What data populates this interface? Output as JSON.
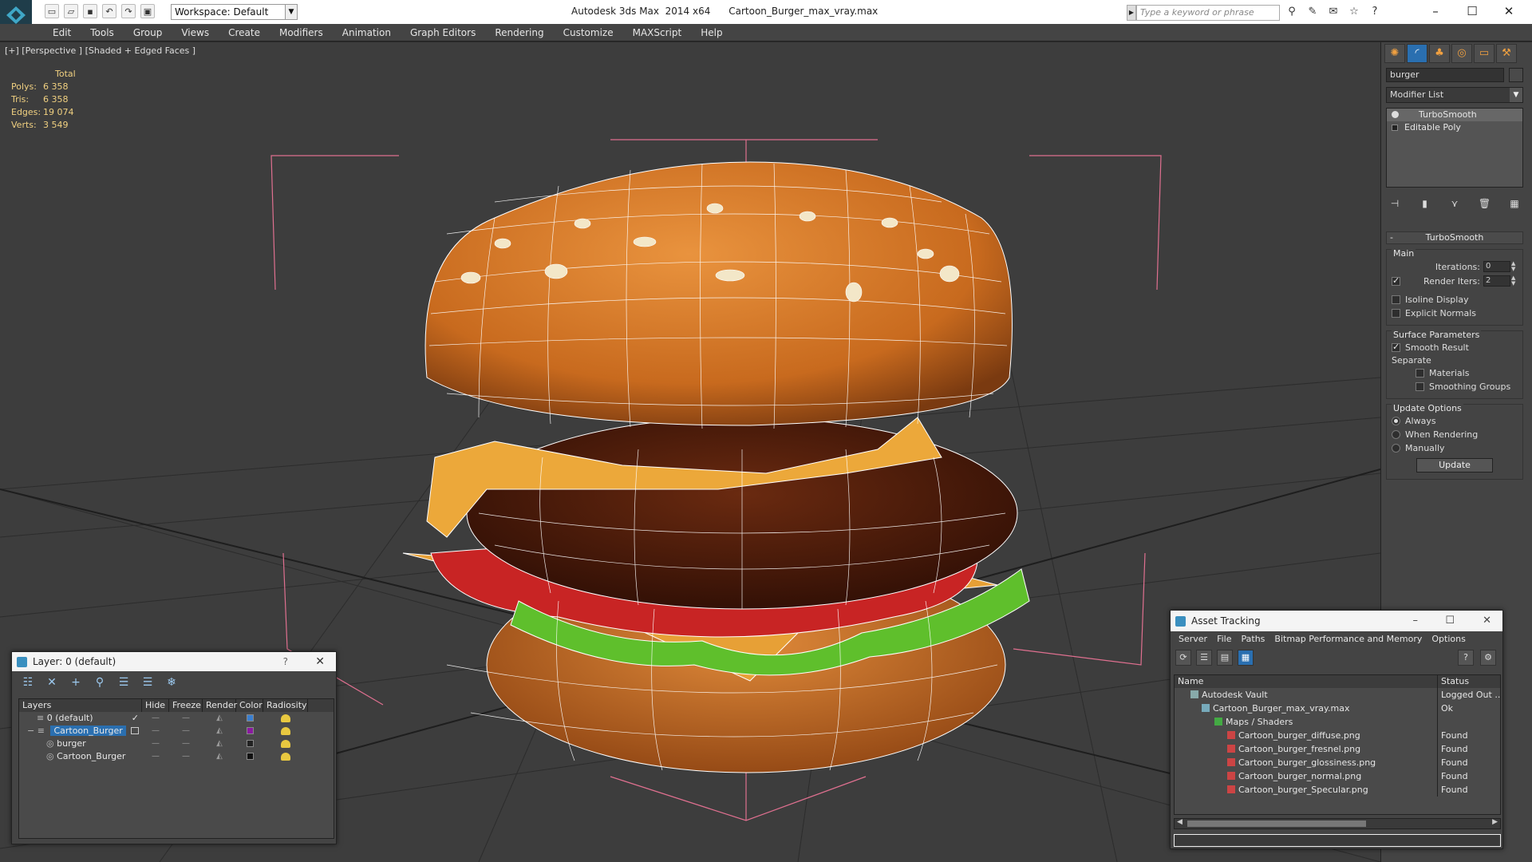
{
  "app": {
    "title": "Autodesk 3ds Max  2014 x64      Cartoon_Burger_max_vray.max",
    "workspace": "Workspace: Default",
    "search_placeholder": "Type a keyword or phrase"
  },
  "menu": [
    "Edit",
    "Tools",
    "Group",
    "Views",
    "Create",
    "Modifiers",
    "Animation",
    "Graph Editors",
    "Rendering",
    "Customize",
    "MAXScript",
    "Help"
  ],
  "viewport": {
    "label": "[+] [Perspective ] [Shaded + Edged Faces ]",
    "stats": {
      "header": "Total",
      "rows": [
        {
          "k": "Polys:",
          "v": "6 358"
        },
        {
          "k": "Tris:",
          "v": "6 358"
        },
        {
          "k": "Edges:",
          "v": "19 074"
        },
        {
          "k": "Verts:",
          "v": "3 549"
        }
      ]
    }
  },
  "command_panel": {
    "object_name": "burger",
    "modifier_list": "Modifier List",
    "stack": [
      "TurboSmooth",
      "Editable Poly"
    ],
    "rollout": {
      "title": "TurboSmooth",
      "main_label": "Main",
      "iterations_label": "Iterations:",
      "iterations_value": "0",
      "render_iters_label": "Render Iters:",
      "render_iters_value": "2",
      "isoline": "Isoline Display",
      "explicit_normals": "Explicit Normals",
      "surface_label": "Surface Parameters",
      "smooth_result": "Smooth Result",
      "separate_label": "Separate",
      "materials": "Materials",
      "smoothing_groups": "Smoothing Groups",
      "update_label": "Update Options",
      "always": "Always",
      "when_rendering": "When Rendering",
      "manually": "Manually",
      "update_button": "Update"
    }
  },
  "layer_window": {
    "title": "Layer: 0 (default)",
    "help": "?",
    "columns": [
      "Layers",
      "Hide",
      "Freeze",
      "Render",
      "Color",
      "Radiosity"
    ],
    "rows": [
      {
        "name": "0 (default)",
        "color": "#3a7fd0"
      },
      {
        "name": "Cartoon_Burger",
        "color": "#8a1aa0"
      },
      {
        "name": "burger",
        "color": "#222222"
      },
      {
        "name": "Cartoon_Burger",
        "color": "#111111"
      }
    ]
  },
  "asset_window": {
    "title": "Asset Tracking",
    "menu": [
      "Server",
      "File",
      "Paths",
      "Bitmap Performance and Memory",
      "Options"
    ],
    "columns": [
      "Name",
      "Status"
    ],
    "rows": [
      {
        "name": "Autodesk Vault",
        "status": "Logged Out ..."
      },
      {
        "name": "Cartoon_Burger_max_vray.max",
        "status": "Ok"
      },
      {
        "name": "Maps / Shaders",
        "status": ""
      },
      {
        "name": "Cartoon_burger_diffuse.png",
        "status": "Found"
      },
      {
        "name": "Cartoon_burger_fresnel.png",
        "status": "Found"
      },
      {
        "name": "Cartoon_burger_glossiness.png",
        "status": "Found"
      },
      {
        "name": "Cartoon_burger_normal.png",
        "status": "Found"
      },
      {
        "name": "Cartoon_burger_Specular.png",
        "status": "Found"
      }
    ]
  }
}
